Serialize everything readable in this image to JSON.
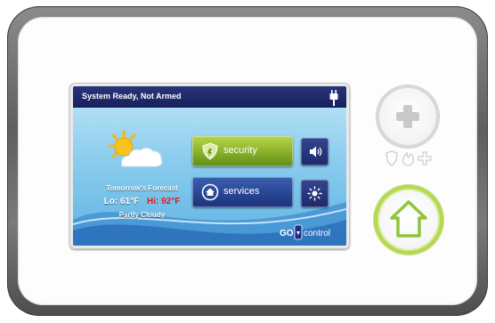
{
  "status_bar": {
    "text": "System Ready, Not Armed",
    "icon": "power-plug-icon"
  },
  "weather": {
    "icon": "partly-cloudy-icon",
    "title": "Tomorrow's Forecast",
    "low": "Lo: 61°F",
    "high": "Hi: 92°F",
    "condition": "Partly Cloudy"
  },
  "buttons": {
    "security": "security",
    "services": "services"
  },
  "brand": {
    "text": "control"
  },
  "colors": {
    "status_bar": "#1e2968",
    "security_green": "#8cb32c",
    "services_blue": "#2a4898",
    "high_temp_red": "#d62020",
    "home_ring": "#b6d94c"
  }
}
